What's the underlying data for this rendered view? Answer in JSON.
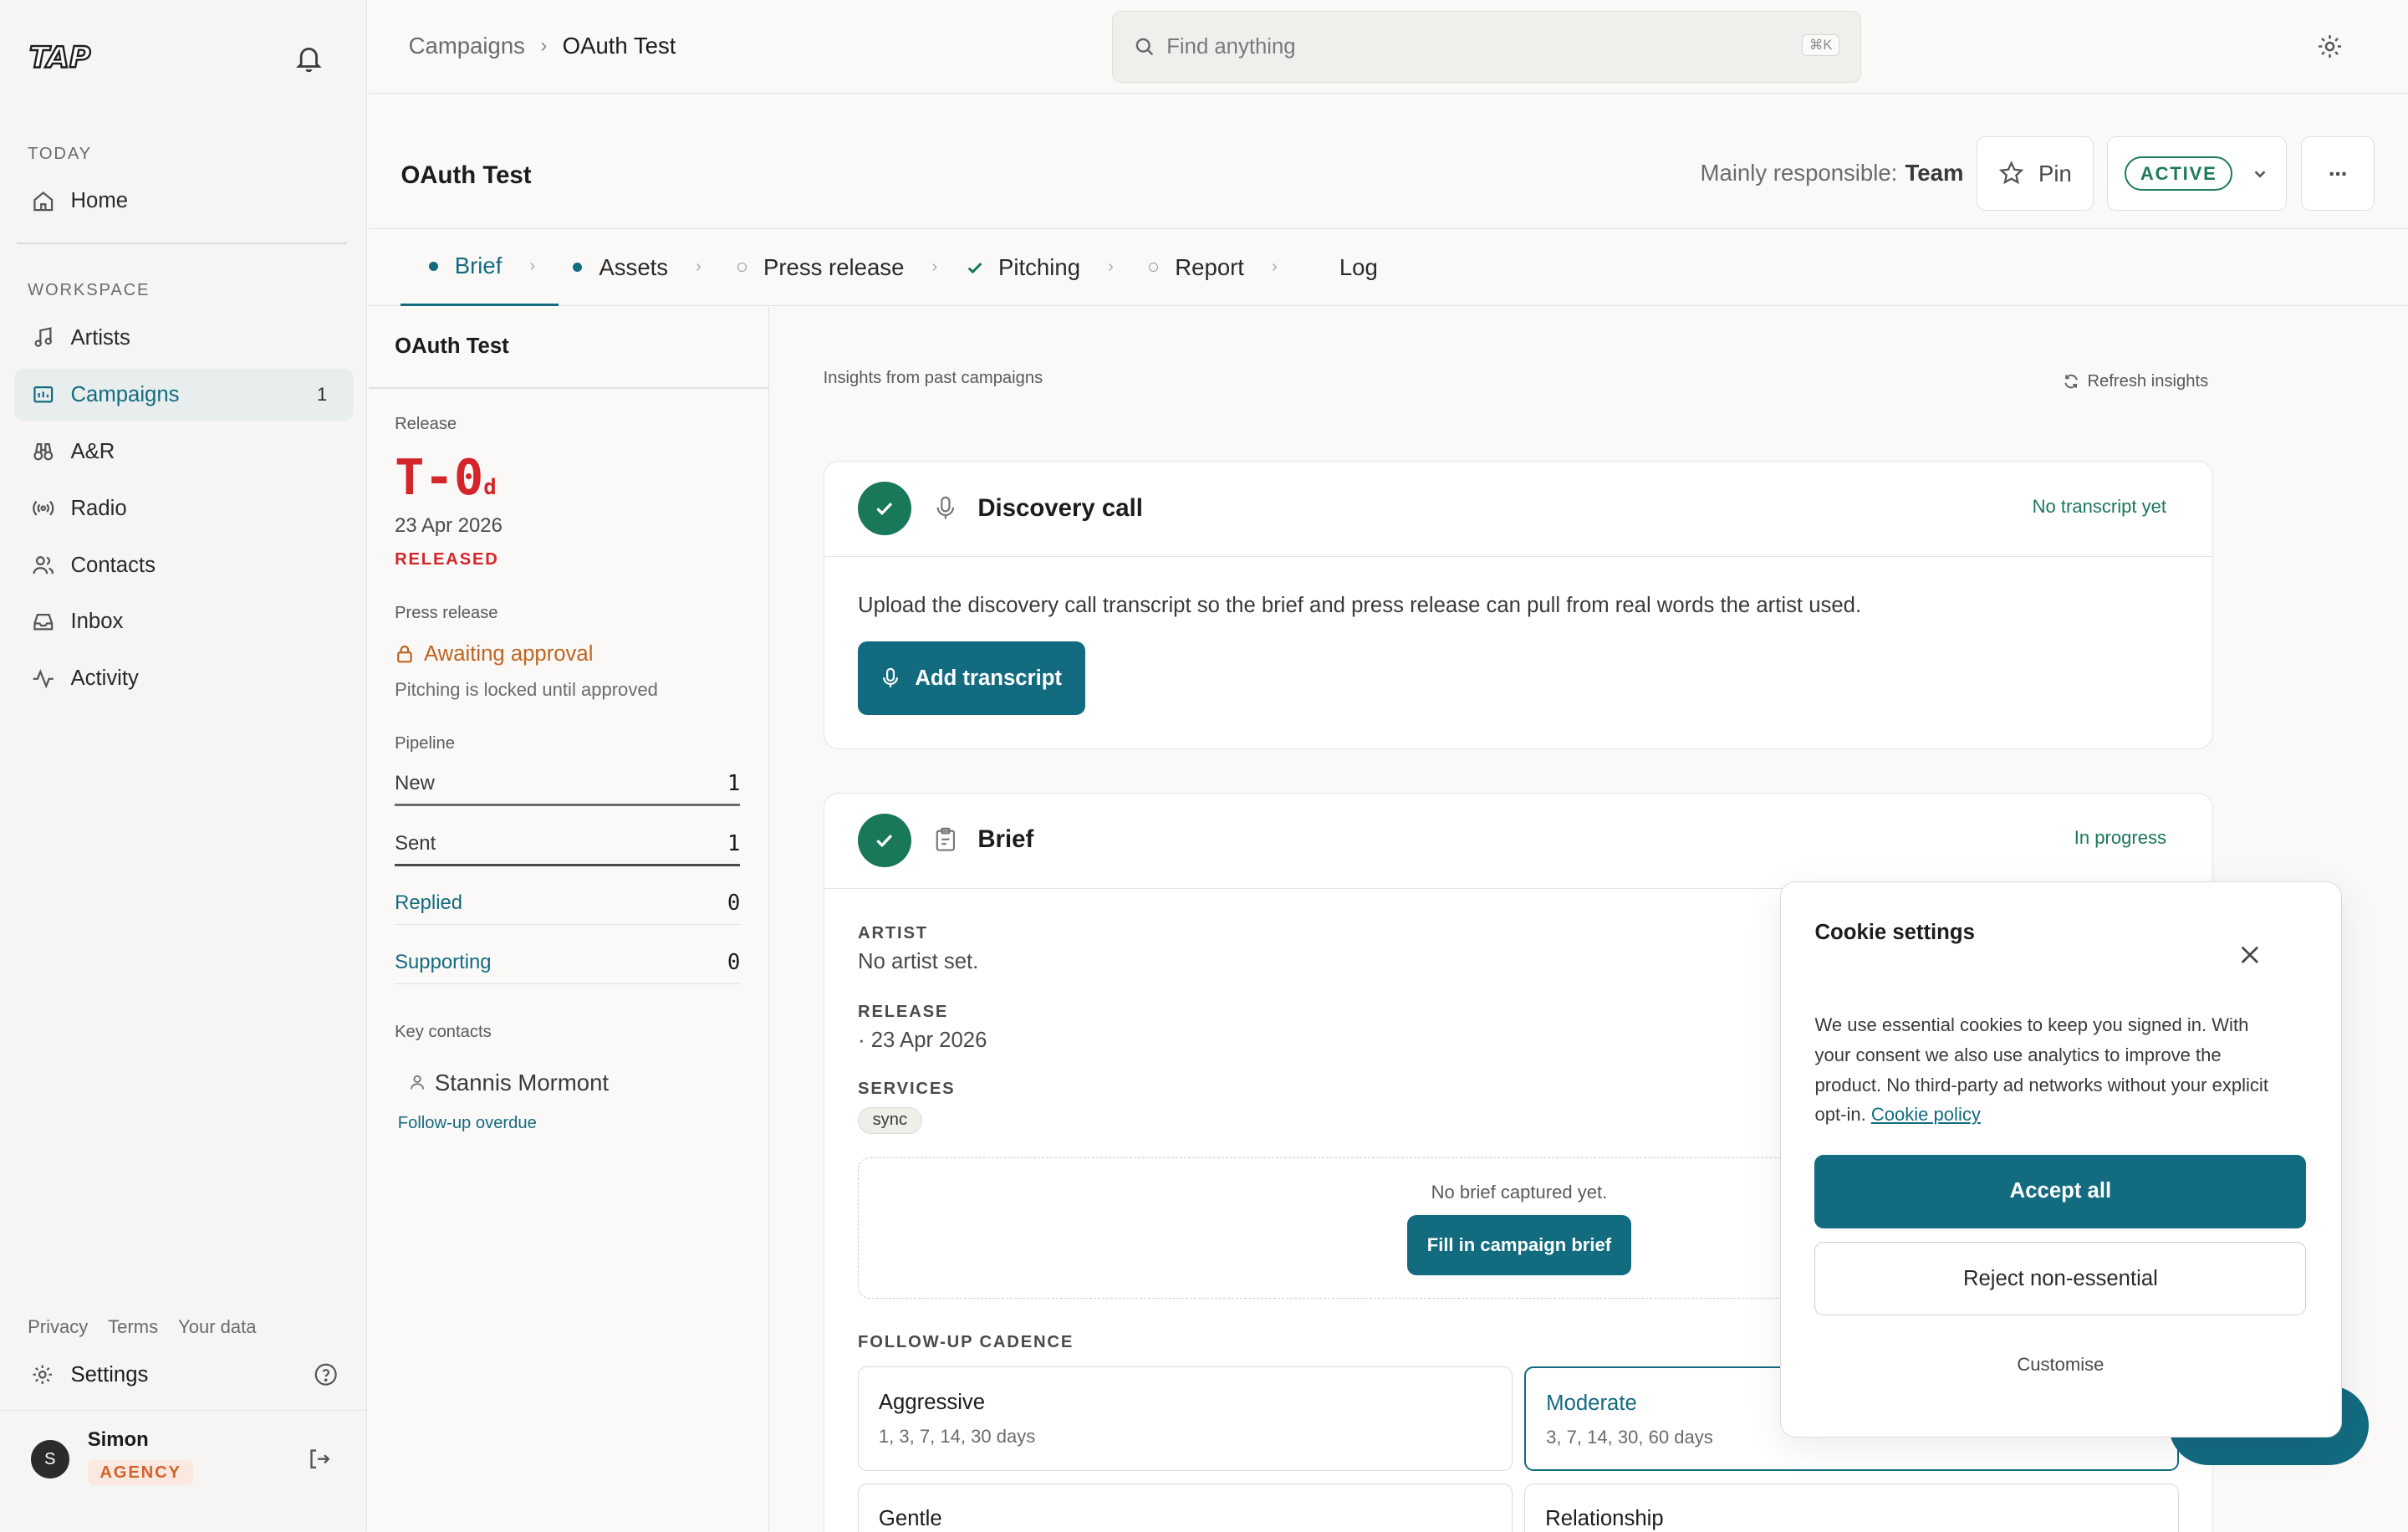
{
  "app": {
    "logo_text": "TAP"
  },
  "sidebar": {
    "today_label": "TODAY",
    "workspace_label": "WORKSPACE",
    "home": "Home",
    "items": [
      {
        "label": "Artists",
        "icon": "music-note-icon"
      },
      {
        "label": "Campaigns",
        "icon": "folder-icon",
        "count": "1",
        "active": true
      },
      {
        "label": "A&R",
        "icon": "binoculars-icon"
      },
      {
        "label": "Radio",
        "icon": "radio-icon"
      },
      {
        "label": "Contacts",
        "icon": "users-icon"
      },
      {
        "label": "Inbox",
        "icon": "inbox-icon"
      },
      {
        "label": "Activity",
        "icon": "activity-icon"
      }
    ],
    "legal": [
      "Privacy",
      "Terms",
      "Your data"
    ],
    "settings": "Settings",
    "user": {
      "initial": "S",
      "name": "Simon",
      "role": "AGENCY"
    }
  },
  "topbar": {
    "breadcrumb": [
      "Campaigns",
      "OAuth Test"
    ],
    "search_placeholder": "Find anything",
    "search_shortcut": "⌘K"
  },
  "header": {
    "title": "OAuth Test",
    "responsible_label": "Mainly responsible:",
    "responsible_value": "Team",
    "pin_label": "Pin",
    "status": "ACTIVE",
    "more_label": "···"
  },
  "tabs": [
    {
      "label": "Brief",
      "state": "current"
    },
    {
      "label": "Assets",
      "state": "dot"
    },
    {
      "label": "Press release",
      "state": "empty"
    },
    {
      "label": "Pitching",
      "state": "done"
    },
    {
      "label": "Report",
      "state": "empty"
    },
    {
      "label": "Log",
      "state": "none"
    }
  ],
  "left_panel": {
    "title": "OAuth Test",
    "release_label": "Release",
    "countdown": "T-0",
    "countdown_unit": "d",
    "release_date": "23 Apr 2026",
    "release_status": "RELEASED",
    "press_label": "Press release",
    "press_status": "Awaiting approval",
    "press_note": "Pitching is locked until approved",
    "pipeline_label": "Pipeline",
    "pipeline": [
      {
        "label": "New",
        "value": "1"
      },
      {
        "label": "Sent",
        "value": "1"
      },
      {
        "label": "Replied",
        "value": "0"
      },
      {
        "label": "Supporting",
        "value": "0"
      }
    ],
    "contacts_label": "Key contacts",
    "contact_name": "Stannis Mormont",
    "contact_note": "Follow-up overdue"
  },
  "main": {
    "insights_label": "Insights from past campaigns",
    "refresh_label": "Refresh insights",
    "discovery": {
      "title": "Discovery call",
      "status": "No transcript yet",
      "body": "Upload the discovery call transcript so the brief and press release can pull from real words the artist used.",
      "button": "Add transcript"
    },
    "brief": {
      "title": "Brief",
      "status": "In progress",
      "artist_label": "ARTIST",
      "artist_value": "No artist set.",
      "release_label": "RELEASE",
      "release_value": "· 23 Apr 2026",
      "services_label": "SERVICES",
      "service_tag": "sync",
      "empty_text": "No brief captured yet.",
      "fill_button": "Fill in campaign brief",
      "cadence_label": "FOLLOW-UP CADENCE",
      "cadences": [
        {
          "name": "Aggressive",
          "days": "1, 3, 7, 14, 30 days"
        },
        {
          "name": "Moderate",
          "days": "3, 7, 14, 30, 60 days",
          "selected": true
        },
        {
          "name": "Gentle",
          "days": ""
        },
        {
          "name": "Relationship",
          "days": ""
        }
      ]
    }
  },
  "cookie": {
    "title": "Cookie settings",
    "body": "We use essential cookies to keep you signed in. With your consent we also use analytics to improve the product. No third-party ad networks without your explicit opt-in.",
    "link": "Cookie policy",
    "accept": "Accept all",
    "reject": "Reject non-essential",
    "customise": "Customise"
  },
  "colors": {
    "accent": "#136b80",
    "success": "#19775a",
    "danger": "#d4262a",
    "warning": "#c0641f"
  }
}
